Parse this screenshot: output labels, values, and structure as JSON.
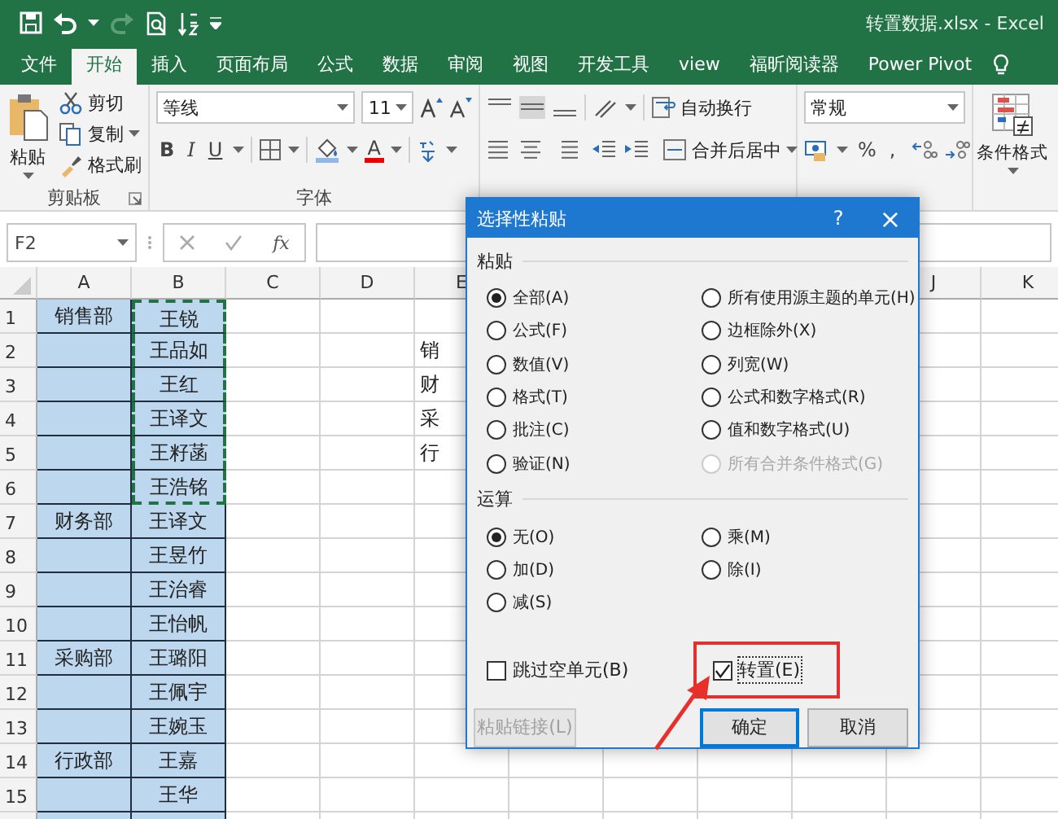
{
  "window": {
    "title": "转置数据.xlsx  -  Excel"
  },
  "menu_tabs": [
    {
      "label": "文件",
      "selected": false
    },
    {
      "label": "开始",
      "selected": true
    },
    {
      "label": "插入",
      "selected": false
    },
    {
      "label": "页面布局",
      "selected": false
    },
    {
      "label": "公式",
      "selected": false
    },
    {
      "label": "数据",
      "selected": false
    },
    {
      "label": "审阅",
      "selected": false
    },
    {
      "label": "视图",
      "selected": false
    },
    {
      "label": "开发工具",
      "selected": false
    },
    {
      "label": "view",
      "selected": false
    },
    {
      "label": "福昕阅读器",
      "selected": false
    },
    {
      "label": "Power Pivot",
      "selected": false
    }
  ],
  "ribbon": {
    "clipboard": {
      "paste": "粘贴",
      "cut": "剪切",
      "copy": "复制",
      "format_painter": "格式刷",
      "group_label": "剪贴板"
    },
    "font": {
      "font_name": "等线",
      "font_size": "11",
      "bold": "B",
      "italic": "I",
      "underline": "U",
      "font_color": "A",
      "group_label": "字体"
    },
    "alignment": {
      "wrap_text": "自动换行",
      "merge_center": "合并后居中"
    },
    "number": {
      "format": "常规",
      "percent": "%",
      "comma": ","
    },
    "styles": {
      "conditional_formatting": "条件格式"
    }
  },
  "formula_bar": {
    "name_box": "F2",
    "function_label": "fx"
  },
  "sheet": {
    "columns_left": [
      "A",
      "B",
      "C",
      "D",
      "E"
    ],
    "columns_right": [
      "J",
      "K"
    ],
    "rows": [
      {
        "label": "1",
        "column_a": {
          "text": "销售部",
          "filled": true
        },
        "column_b": {
          "text": "王锐",
          "filled": true,
          "copied": true
        }
      },
      {
        "label": "2",
        "column_a": {
          "filled": true
        },
        "column_b": {
          "text": "王品如",
          "filled": true,
          "copied": true
        },
        "column_e": "销"
      },
      {
        "label": "3",
        "column_a": {
          "filled": true
        },
        "column_b": {
          "text": "王红",
          "filled": true,
          "copied": true
        },
        "column_e": "财"
      },
      {
        "label": "4",
        "column_a": {
          "filled": true
        },
        "column_b": {
          "text": "王译文",
          "filled": true,
          "copied": true
        },
        "column_e": "采"
      },
      {
        "label": "5",
        "column_a": {
          "filled": true
        },
        "column_b": {
          "text": "王籽菡",
          "filled": true,
          "copied": true
        },
        "column_e": "行"
      },
      {
        "label": "6",
        "column_a": {
          "filled": true
        },
        "column_b": {
          "text": "王浩铭",
          "filled": true,
          "copied": true
        }
      },
      {
        "label": "7",
        "column_a": {
          "text": "财务部",
          "filled": true
        },
        "column_b": {
          "text": "王译文",
          "filled": true,
          "copied": false
        }
      },
      {
        "label": "8",
        "column_a": {
          "filled": true
        },
        "column_b": {
          "text": "王昱竹",
          "filled": true,
          "copied": false
        }
      },
      {
        "label": "9",
        "column_a": {
          "filled": true
        },
        "column_b": {
          "text": "王治睿",
          "filled": true,
          "copied": false
        }
      },
      {
        "label": "10",
        "column_a": {
          "filled": true
        },
        "column_b": {
          "text": "王怡帆",
          "filled": true,
          "copied": false
        }
      },
      {
        "label": "11",
        "column_a": {
          "text": "采购部",
          "filled": true
        },
        "column_b": {
          "text": "王璐阳",
          "filled": true,
          "copied": false
        }
      },
      {
        "label": "12",
        "column_a": {
          "filled": true
        },
        "column_b": {
          "text": "王佩宇",
          "filled": true,
          "copied": false
        }
      },
      {
        "label": "13",
        "column_a": {
          "filled": true
        },
        "column_b": {
          "text": "王婉玉",
          "filled": true,
          "copied": false
        }
      },
      {
        "label": "14",
        "column_a": {
          "text": "行政部",
          "filled": true
        },
        "column_b": {
          "text": "王嘉",
          "filled": true,
          "copied": false
        }
      },
      {
        "label": "15",
        "column_a": {
          "filled": true
        },
        "column_b": {
          "text": "王华",
          "filled": true,
          "copied": false
        }
      },
      {
        "column_a": {
          "filled": true
        },
        "column_b": {
          "filled": true,
          "copied": false
        }
      }
    ]
  },
  "dialog": {
    "title": "选择性粘贴",
    "help": "?",
    "close": "×",
    "paste_section": {
      "label": "粘贴",
      "options": [
        {
          "label": "全部(A)",
          "selected": true,
          "disabled": false
        },
        {
          "label": "公式(F)",
          "selected": false,
          "disabled": false
        },
        {
          "label": "数值(V)",
          "selected": false,
          "disabled": false
        },
        {
          "label": "格式(T)",
          "selected": false,
          "disabled": false
        },
        {
          "label": "批注(C)",
          "selected": false,
          "disabled": false
        },
        {
          "label": "验证(N)",
          "selected": false,
          "disabled": false
        },
        {
          "label": "所有使用源主题的单元(H)",
          "selected": false,
          "disabled": false
        },
        {
          "label": "边框除外(X)",
          "selected": false,
          "disabled": false
        },
        {
          "label": "列宽(W)",
          "selected": false,
          "disabled": false
        },
        {
          "label": "公式和数字格式(R)",
          "selected": false,
          "disabled": false
        },
        {
          "label": "值和数字格式(U)",
          "selected": false,
          "disabled": false
        },
        {
          "label": "所有合并条件格式(G)",
          "selected": false,
          "disabled": true
        }
      ]
    },
    "operation_section": {
      "label": "运算",
      "options": [
        {
          "label": "无(O)",
          "selected": true
        },
        {
          "label": "加(D)",
          "selected": false
        },
        {
          "label": "减(S)",
          "selected": false
        },
        {
          "label": "乘(M)",
          "selected": false
        },
        {
          "label": "除(I)",
          "selected": false
        }
      ]
    },
    "checkboxes": [
      {
        "label": "跳过空单元(B)",
        "checked": false,
        "highlighted": false
      },
      {
        "label": "转置(E)",
        "checked": true,
        "highlighted": true
      }
    ],
    "buttons": [
      {
        "label": "粘贴链接(L)",
        "kind": "link",
        "disabled": true
      },
      {
        "label": "确定",
        "kind": "ok",
        "disabled": false
      },
      {
        "label": "取消",
        "kind": "cancel",
        "disabled": false
      }
    ]
  }
}
